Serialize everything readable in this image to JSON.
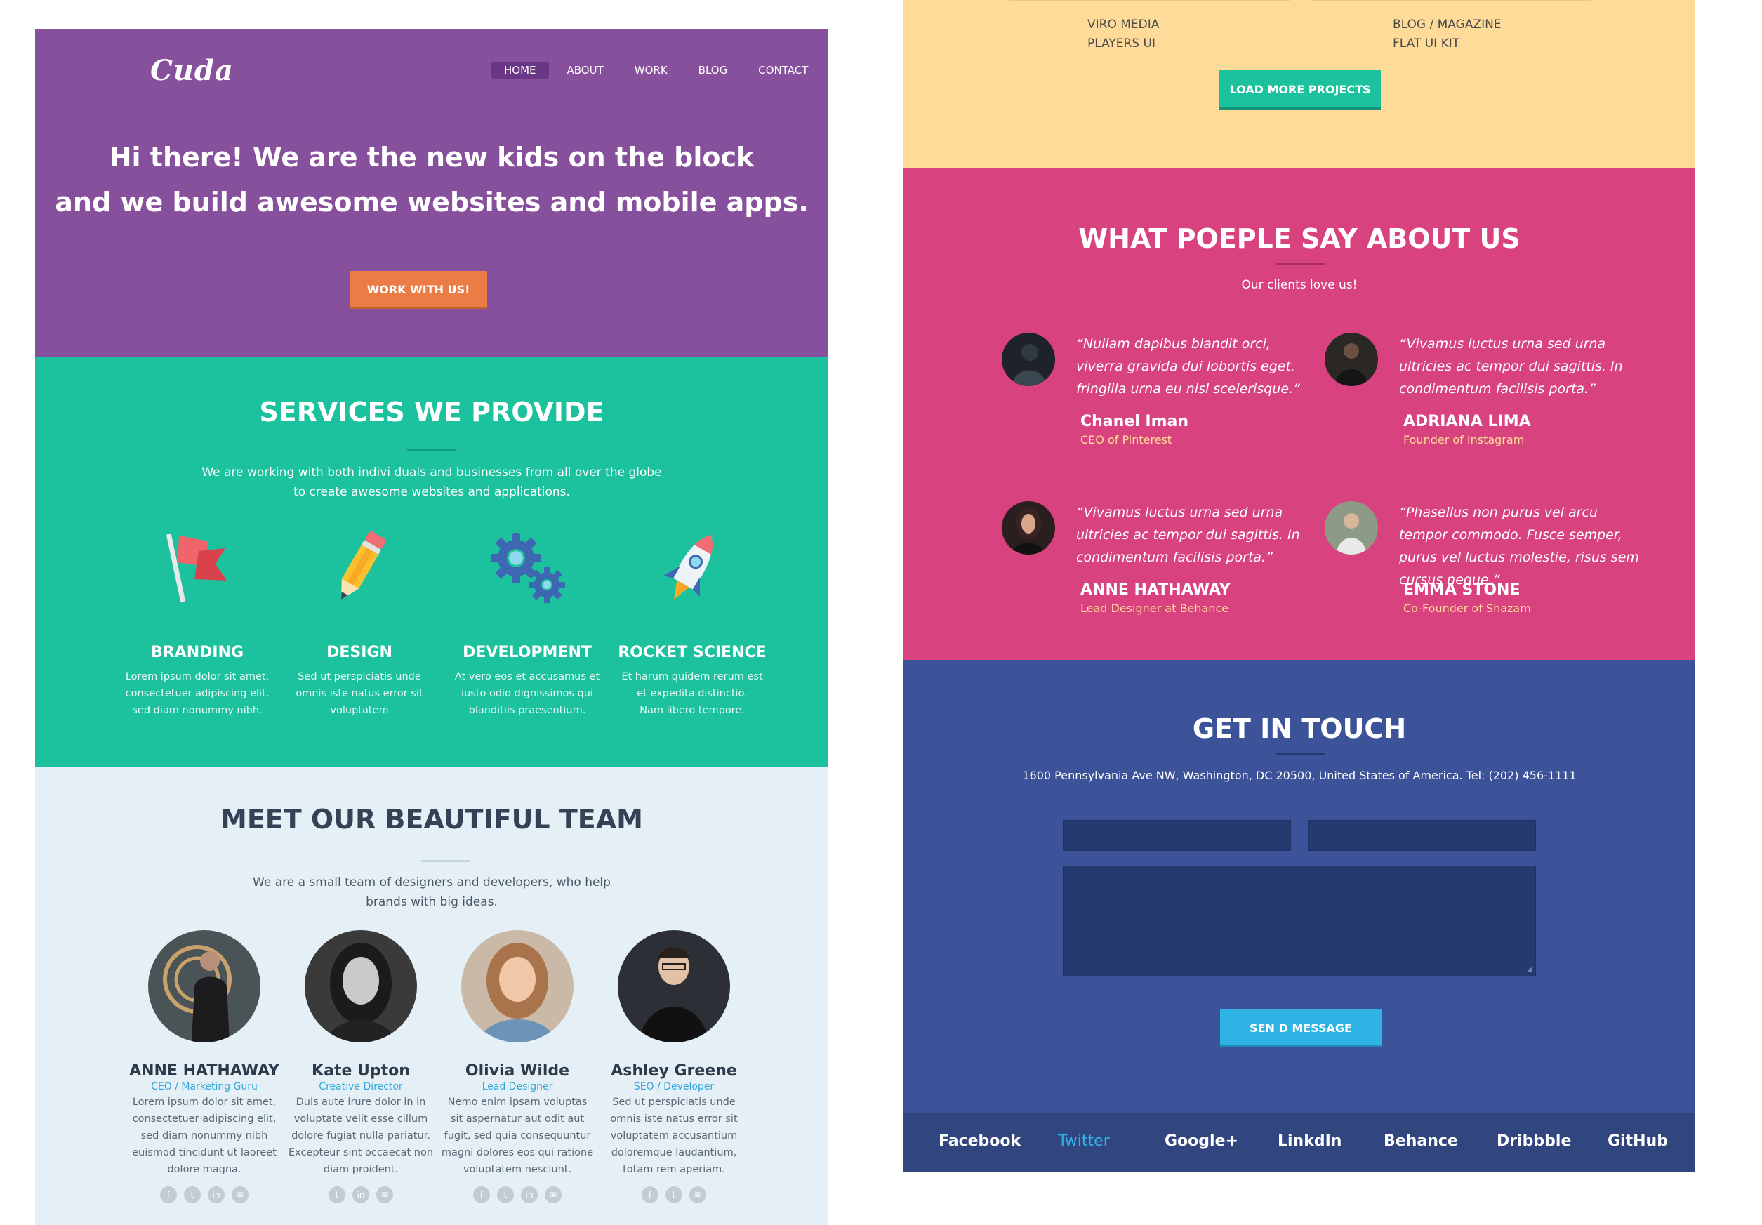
{
  "hero": {
    "logo": "Cuda",
    "nav": [
      "HOME",
      "ABOUT",
      "WORK",
      "BLOG",
      "CONTACT"
    ],
    "title_line1": "Hi there! We are the new kids on the block",
    "title_line2": "and we build awesome websites and mobile apps.",
    "cta": "WORK WITH US!"
  },
  "services": {
    "title": "SERVICES WE PROVIDE",
    "subtitle_line1": "We are working with both indivi duals and businesses from all over the globe",
    "subtitle_line2": "to create awesome websites and applications.",
    "items": [
      {
        "icon": "flag-icon",
        "name": "BRANDING",
        "desc": [
          "Lorem ipsum dolor sit amet,",
          "consectetuer adipiscing elit,",
          "sed diam nonummy nibh."
        ]
      },
      {
        "icon": "pencil-icon",
        "name": "DESIGN",
        "desc": [
          "Sed ut perspiciatis unde",
          "omnis iste natus error sit",
          "voluptatem"
        ]
      },
      {
        "icon": "gears-icon",
        "name": "DEVELOPMENT",
        "desc": [
          "At vero eos et accusamus et",
          "iusto odio dignissimos qui",
          "blanditiis praesentium."
        ]
      },
      {
        "icon": "rocket-icon",
        "name": "ROCKET SCIENCE",
        "desc": [
          "Et harum quidem rerum est",
          "et expedita distinctio.",
          "Nam libero tempore."
        ]
      }
    ]
  },
  "team": {
    "title": "MEET OUR BEAUTIFUL TEAM",
    "subtitle_line1": "We are a small team of designers and developers, who help",
    "subtitle_line2": "brands with big ideas.",
    "members": [
      {
        "name": "ANNE HATHAWAY",
        "role": "CEO / Marketing Guru",
        "bio": [
          "Lorem ipsum dolor sit amet,",
          "consectetuer adipiscing elit,",
          "sed diam nonummy nibh",
          "euismod tincidunt ut laoreet",
          "dolore magna."
        ]
      },
      {
        "name": "Kate Upton",
        "role": "Creative Director",
        "bio": [
          "Duis aute irure dolor in in",
          "voluptate velit esse cillum",
          "dolore fugiat nulla pariatur.",
          "Excepteur sint occaecat non",
          "diam proident."
        ]
      },
      {
        "name": "Olivia Wilde",
        "role": "Lead Designer",
        "bio": [
          "Nemo enim ipsam voluptas",
          "sit aspernatur aut odit aut",
          "fugit, sed quia consequuntur",
          "magni dolores eos qui ratione",
          "voluptatem nesciunt."
        ]
      },
      {
        "name": "Ashley Greene",
        "role": "SEO / Developer",
        "bio": [
          "Sed ut perspiciatis unde",
          "omnis iste natus error sit",
          "voluptatem accusantium",
          "doloremque laudantium,",
          "totam rem aperiam."
        ]
      }
    ]
  },
  "portfolio": {
    "col1": [
      "VIRO MEDIA",
      "PLAYERS UI"
    ],
    "col2": [
      "BLOG / MAGAZINE",
      "FLAT UI KIT"
    ],
    "load_more": "LOAD MORE PROJECTS"
  },
  "testimonials": {
    "title": "WHAT POEPLE SAY ABOUT US",
    "subtitle": "Our clients love us!",
    "items": [
      {
        "quote": "“Nullam dapibus blandit orci, viverra gravida dui lobortis eget. fringilla urna eu nisl scelerisque.”",
        "name": "Chanel Iman",
        "role": "CEO of Pinterest"
      },
      {
        "quote": "“Vivamus luctus urna sed urna ultricies ac tempor dui sagittis. In condimentum facilisis porta.”",
        "name": "ADRIANA LIMA",
        "role": "Founder of Instagram"
      },
      {
        "quote": "“Vivamus luctus urna sed urna ultricies ac tempor dui sagittis. In condimentum facilisis porta.”",
        "name": "ANNE HATHAWAY",
        "role": "Lead Designer at Behance"
      },
      {
        "quote": "“Phasellus non purus vel arcu tempor commodo. Fusce semper, purus vel luctus molestie, risus sem cursus neque.”",
        "name": "EMMA STONE",
        "role": "Co-Founder of Shazam"
      }
    ]
  },
  "contact": {
    "title": "GET IN TOUCH",
    "address": "1600 Pennsylvania Ave NW, Washington, DC 20500, United States of America. Tel: (202) 456-1111",
    "send": "SEN D MESSAGE"
  },
  "footer": {
    "links": [
      "Facebook",
      "Twitter",
      "Google+",
      "LinkdIn",
      "Behance",
      "Dribbble",
      "GitHub"
    ]
  },
  "colors": {
    "hero": "#87509d",
    "services": "#1cc19e",
    "team": "#e5f0f6",
    "portfolio": "#fedb98",
    "testimonials": "#d8437f",
    "contact": "#3c5399",
    "accent_orange": "#ec7c45",
    "accent_blue": "#2eb3e4"
  }
}
